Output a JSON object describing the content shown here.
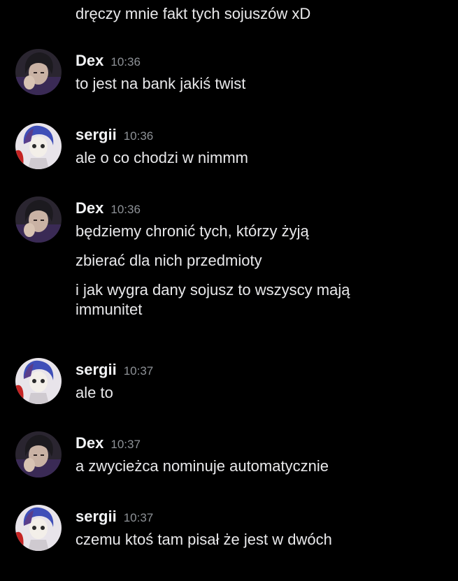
{
  "chat": {
    "continuation_text": "dręczy mnie fakt tych sojuszów xD",
    "groups": [
      {
        "user": "Dex",
        "time": "10:36",
        "avatar": "dex-avatar",
        "messages": [
          "to jest na bank jakiś twist"
        ]
      },
      {
        "user": "sergii",
        "time": "10:36",
        "avatar": "sergii-avatar",
        "messages": [
          "ale o co chodzi w nimmm"
        ]
      },
      {
        "user": "Dex",
        "time": "10:36",
        "avatar": "dex-avatar",
        "messages": [
          "będziemy chronić tych, którzy żyją",
          "zbierać dla nich przedmioty",
          "i jak wygra dany sojusz to wszyscy mają immunitet"
        ]
      },
      {
        "user": "sergii",
        "time": "10:37",
        "avatar": "sergii-avatar",
        "messages": [
          "ale to"
        ]
      },
      {
        "user": "Dex",
        "time": "10:37",
        "avatar": "dex-avatar",
        "messages": [
          "a zwycieżca nominuje automatycznie"
        ]
      },
      {
        "user": "sergii",
        "time": "10:37",
        "avatar": "sergii-avatar",
        "messages": [
          "czemu ktoś tam pisał że jest w dwóch"
        ]
      }
    ]
  },
  "colors": {
    "background": "#000000",
    "username": "#f2f3f5",
    "message": "#e9e9eb",
    "timestamp": "#8e9297"
  }
}
